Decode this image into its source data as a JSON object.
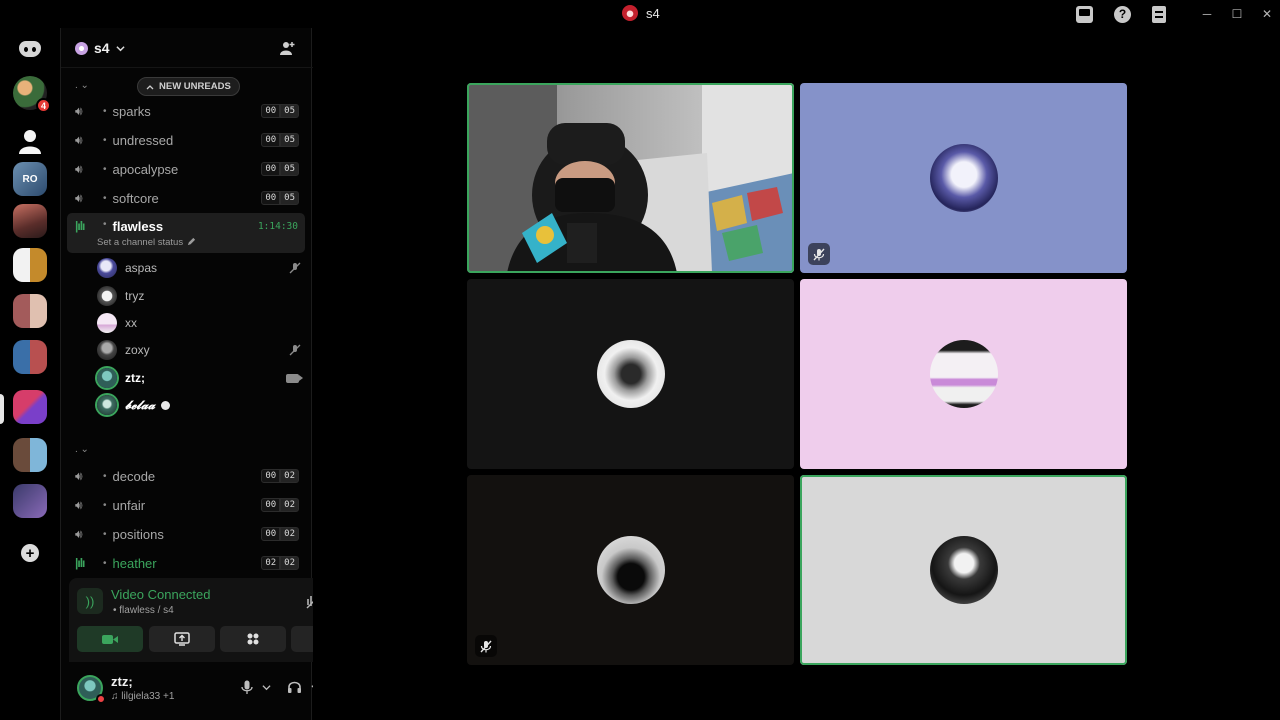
{
  "window": {
    "title": "s4",
    "controls": {
      "minimize": "─",
      "maximize": "☐",
      "close": "✕"
    }
  },
  "server": {
    "name": "s4",
    "new_unreads_label": "NEW UNREADS",
    "category_1": ".",
    "category_2": ".",
    "channels_top": [
      {
        "name": "sparks",
        "count_a": "00",
        "count_b": "05"
      },
      {
        "name": "undressed",
        "count_a": "00",
        "count_b": "05"
      },
      {
        "name": "apocalypse",
        "count_a": "00",
        "count_b": "05"
      },
      {
        "name": "softcore",
        "count_a": "00",
        "count_b": "05"
      }
    ],
    "active_channel": {
      "name": "flawless",
      "timer": "1:14:30",
      "status_prompt": "Set a channel status"
    },
    "members": [
      {
        "name": "aspas",
        "muted": true
      },
      {
        "name": "tryz"
      },
      {
        "name": "xx"
      },
      {
        "name": "zoxy",
        "muted": true
      },
      {
        "name": "ztz;",
        "video": true
      },
      {
        "name": "𝓫𝓮𝓵𝓪𝓪"
      }
    ],
    "channels_bottom": [
      {
        "name": "decode",
        "count_a": "00",
        "count_b": "02"
      },
      {
        "name": "unfair",
        "count_a": "00",
        "count_b": "02"
      },
      {
        "name": "positions",
        "count_a": "00",
        "count_b": "02"
      },
      {
        "name": "heather",
        "count_a": "02",
        "count_b": "02"
      }
    ]
  },
  "rail": {
    "badge": "4"
  },
  "voice": {
    "status": "Video Connected",
    "location": "flawless / s4"
  },
  "user": {
    "name": "ztz;",
    "activity": "lilgiela33 +1"
  },
  "colors": {
    "accent_green": "#3ba55d",
    "tile_blue": "#8592c9",
    "tile_pink": "#efcdec",
    "tile_grey": "#d8d8d8",
    "tile_dark": "#141414"
  }
}
